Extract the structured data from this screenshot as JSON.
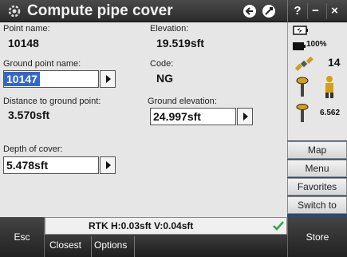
{
  "window": {
    "title": "Compute pipe cover",
    "help_label": "?",
    "minimize_label": "−",
    "close_label": "×"
  },
  "form": {
    "point_name_label": "Point name:",
    "point_name_value": "10148",
    "elevation_label": "Elevation:",
    "elevation_value": "19.519sft",
    "ground_point_name_label": "Ground point name:",
    "ground_point_name_value": "10147",
    "code_label": "Code:",
    "code_value": "NG",
    "distance_label": "Distance to ground point:",
    "distance_value": "3.570sft",
    "ground_elevation_label": "Ground elevation:",
    "ground_elevation_value": "24.997sft",
    "depth_label": "Depth of cover:",
    "depth_value": "5.478sft"
  },
  "status_panel": {
    "battery_percent": "100%",
    "satellite_count": "14",
    "antenna_height": "6.562"
  },
  "side_buttons": {
    "map": "Map",
    "menu": "Menu",
    "favorites": "Favorites",
    "switch_to": "Switch to"
  },
  "statusline": {
    "rtk_text": "RTK H:0.03sft V:0.04sft"
  },
  "softkeys": {
    "esc": "Esc",
    "closest": "Closest",
    "options": "Options",
    "store": "Store"
  },
  "colors": {
    "selection": "#3366cc",
    "title_bar": "#333333",
    "form_background": "#e6e6e6",
    "check_green": "#3aa040"
  },
  "icons": {
    "app": "gear-app-icon",
    "back": "back-arrow-icon",
    "nav": "compass-icon",
    "battery": "battery-icon",
    "satellite": "satellite-icon",
    "receiver": "gnss-receiver-icon",
    "person": "surveyor-icon",
    "check": "checkmark-icon"
  }
}
